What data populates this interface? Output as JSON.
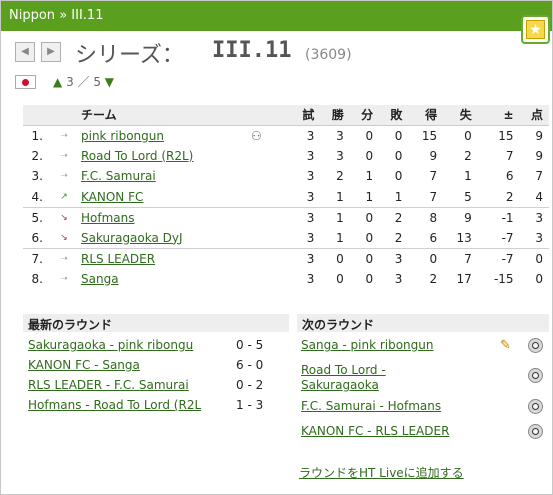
{
  "breadcrumb": {
    "country": "Nippon",
    "sep": "»",
    "league": "III.11"
  },
  "title": {
    "label": "シリーズ：",
    "league": "III.11",
    "count": "(3609)"
  },
  "level": {
    "up": "▲",
    "text": "3 ／ 5",
    "down": "▼"
  },
  "table": {
    "headers": {
      "team": "チーム",
      "played": "試",
      "won": "勝",
      "draw": "分",
      "lost": "敗",
      "for": "得",
      "against": "失",
      "diff": "±",
      "pts": "点"
    },
    "rows": [
      {
        "pos": "1.",
        "change": "eq",
        "team": "pink ribongun",
        "p": "3",
        "w": "3",
        "d": "0",
        "l": "0",
        "f": "15",
        "a": "0",
        "gd": "15",
        "pts": "9"
      },
      {
        "pos": "2.",
        "change": "eq",
        "team": "Road To Lord (R2L)",
        "p": "3",
        "w": "3",
        "d": "0",
        "l": "0",
        "f": "9",
        "a": "2",
        "gd": "7",
        "pts": "9"
      },
      {
        "pos": "3.",
        "change": "eq",
        "team": "F.C. Samurai",
        "p": "3",
        "w": "2",
        "d": "1",
        "l": "0",
        "f": "7",
        "a": "1",
        "gd": "6",
        "pts": "7"
      },
      {
        "pos": "4.",
        "change": "up",
        "team": "KANON FC",
        "p": "3",
        "w": "1",
        "d": "1",
        "l": "1",
        "f": "7",
        "a": "5",
        "gd": "2",
        "pts": "4"
      },
      {
        "pos": "5.",
        "change": "down",
        "team": "Hofmans",
        "p": "3",
        "w": "1",
        "d": "0",
        "l": "2",
        "f": "8",
        "a": "9",
        "gd": "-1",
        "pts": "3"
      },
      {
        "pos": "6.",
        "change": "down",
        "team": "Sakuragaoka DyJ",
        "p": "3",
        "w": "1",
        "d": "0",
        "l": "2",
        "f": "6",
        "a": "13",
        "gd": "-7",
        "pts": "3"
      },
      {
        "pos": "7.",
        "change": "eq",
        "team": "RLS LEADER",
        "p": "3",
        "w": "0",
        "d": "0",
        "l": "3",
        "f": "0",
        "a": "7",
        "gd": "-7",
        "pts": "0"
      },
      {
        "pos": "8.",
        "change": "eq",
        "team": "Sanga",
        "p": "3",
        "w": "0",
        "d": "0",
        "l": "3",
        "f": "2",
        "a": "17",
        "gd": "-15",
        "pts": "0"
      }
    ]
  },
  "latest": {
    "header": "最新のラウンド",
    "matches": [
      {
        "match": "Sakuragaoka  - pink ribongu",
        "score": "0 - 5"
      },
      {
        "match": "KANON FC - Sanga",
        "score": "6 - 0"
      },
      {
        "match": "RLS LEADER - F.C. Samurai",
        "score": "0 - 2"
      },
      {
        "match": "Hofmans - Road To Lord (R2L",
        "score": "1 - 3"
      }
    ]
  },
  "next": {
    "header": "次のラウンド",
    "matches": [
      {
        "match": "Sanga - pink ribongun"
      },
      {
        "match_line1": "Road To Lord -",
        "match_line2": " Sakuragaoka"
      },
      {
        "match": "F.C. Samurai - Hofmans"
      },
      {
        "match": "KANON FC - RLS LEADER"
      }
    ],
    "add_link": "ラウンドをHT Liveに追加する"
  },
  "colors": {
    "topbar": "#5a9f1e",
    "link": "#2f6b1c",
    "up": "#3a8a2a",
    "down": "#c0302a"
  }
}
